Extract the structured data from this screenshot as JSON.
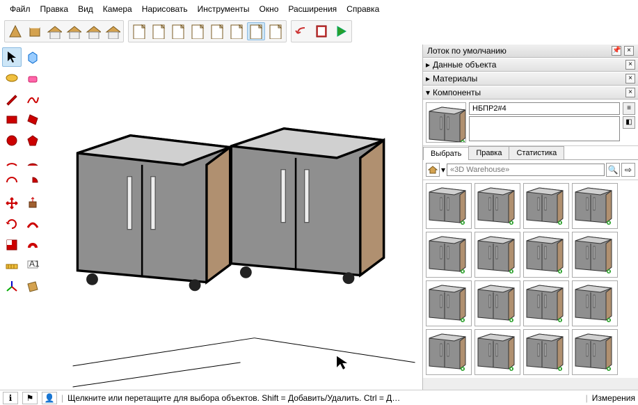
{
  "menu": {
    "items": [
      "Файл",
      "Правка",
      "Вид",
      "Камера",
      "Нарисовать",
      "Инструменты",
      "Окно",
      "Расширения",
      "Справка"
    ]
  },
  "tray": {
    "title": "Лоток по умолчанию",
    "panels": [
      {
        "label": "Данные объекта",
        "open": false
      },
      {
        "label": "Материалы",
        "open": false
      },
      {
        "label": "Компоненты",
        "open": true
      }
    ],
    "component": {
      "name": "НБПР2#4",
      "desc": "",
      "tabs": [
        "Выбрать",
        "Правка",
        "Статистика"
      ],
      "search_placeholder": "«3D Warehouse»"
    }
  },
  "status": {
    "hint": "Щелкните или перетащите для выбора объектов. Shift = Добавить/Удалить. Ctrl = Д…",
    "measure_label": "Измерения"
  },
  "colors": {
    "grey": "#8f8f8f",
    "wood": "#b09070"
  }
}
